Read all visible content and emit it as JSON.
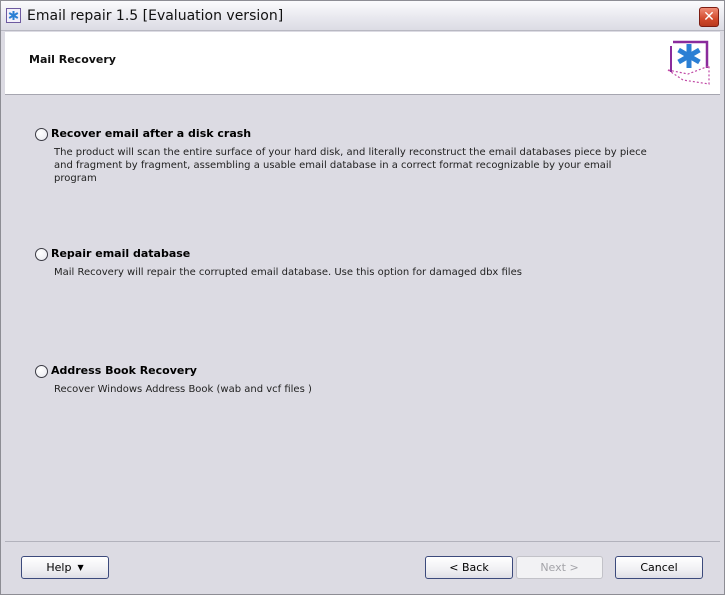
{
  "window": {
    "title": "Email repair 1.5 [Evaluation version]",
    "close_glyph": "✕"
  },
  "header": {
    "title": "Mail Recovery"
  },
  "options": [
    {
      "label": "Recover email after a disk crash",
      "description_lines": [
        "The product will scan the entire surface of your hard disk, and literally reconstruct the email databases piece by piece",
        "and fragment by fragment, assembling a usable email database in a correct format recognizable by your email program"
      ],
      "selected": false
    },
    {
      "label": "Repair email database",
      "description_lines": [
        "Mail Recovery will repair the corrupted email database. Use this option for damaged dbx files"
      ],
      "selected": false
    },
    {
      "label": "Address Book Recovery",
      "description_lines": [
        "Recover Windows Address Book (wab and vcf files )"
      ],
      "selected": false
    }
  ],
  "footer": {
    "help_label": "Help",
    "back_label": "< Back",
    "next_label": "Next >",
    "cancel_label": "Cancel"
  },
  "icons": {
    "app": "app-logo-icon",
    "logo": "asterisk-envelope-logo",
    "close": "close-icon",
    "dropdown": "caret-down-icon"
  },
  "colors": {
    "background": "#dcdbe3",
    "close_button": "#d24a2c",
    "logo_accent": "#2b7fd4",
    "logo_frame": "#8a2b9c"
  }
}
